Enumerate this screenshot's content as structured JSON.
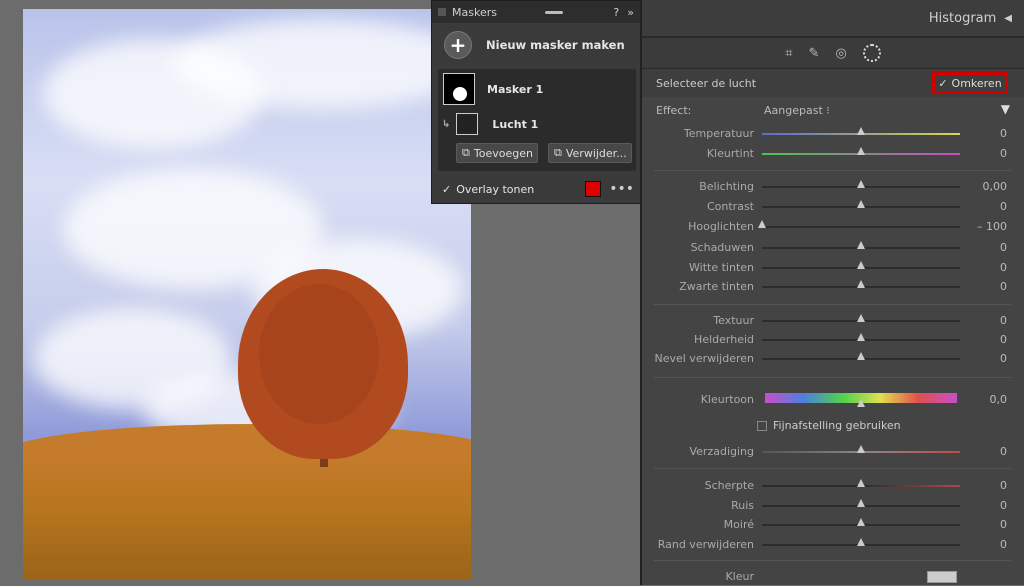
{
  "masks_panel": {
    "title": "Maskers",
    "help": "?",
    "collapse": "»",
    "new_mask": "Nieuw masker maken",
    "mask_name": "Masker 1",
    "component_name": "Lucht 1",
    "add_label": "Toevoegen",
    "remove_label": "Verwijder...",
    "overlay_label": "Overlay tonen",
    "overlay_color": "#d40000"
  },
  "right_panel": {
    "histogram_title": "Histogram",
    "select_label": "Selecteer de lucht",
    "invert_label": "Omkeren",
    "effect_label": "Effect:",
    "effect_value": "Aangepast",
    "sliders": [
      {
        "label": "Temperatuur",
        "value": "0",
        "pos": 0.5
      },
      {
        "label": "Kleurtint",
        "value": "0",
        "pos": 0.5
      },
      {
        "label": "Belichting",
        "value": "0,00",
        "pos": 0.5
      },
      {
        "label": "Contrast",
        "value": "0",
        "pos": 0.5
      },
      {
        "label": "Hooglichten",
        "value": "– 100",
        "pos": 0.0
      },
      {
        "label": "Schaduwen",
        "value": "0",
        "pos": 0.5
      },
      {
        "label": "Witte tinten",
        "value": "0",
        "pos": 0.5
      },
      {
        "label": "Zwarte tinten",
        "value": "0",
        "pos": 0.5
      },
      {
        "label": "Textuur",
        "value": "0",
        "pos": 0.5
      },
      {
        "label": "Helderheid",
        "value": "0",
        "pos": 0.5
      },
      {
        "label": "Nevel verwijderen",
        "value": "0",
        "pos": 0.5
      },
      {
        "label": "Kleurtoon",
        "value": "0,0",
        "pos": 0.5
      },
      {
        "label": "Verzadiging",
        "value": "0",
        "pos": 0.5
      },
      {
        "label": "Scherpte",
        "value": "0",
        "pos": 0.5
      },
      {
        "label": "Ruis",
        "value": "0",
        "pos": 0.5
      },
      {
        "label": "Moiré",
        "value": "0",
        "pos": 0.5
      },
      {
        "label": "Rand verwijderen",
        "value": "0",
        "pos": 0.5
      }
    ],
    "fine_tune_label": "Fijnafstelling gebruiken",
    "color_label": "Kleur"
  }
}
